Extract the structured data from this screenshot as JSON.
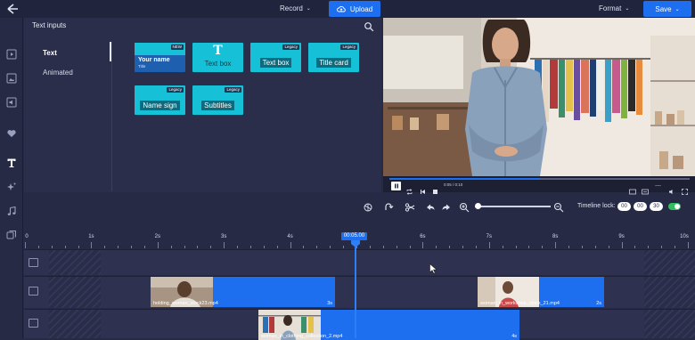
{
  "topbar": {
    "record_label": "Record",
    "upload_label": "Upload",
    "format_label": "Format",
    "save_label": "Save"
  },
  "panel": {
    "title": "Text inputs",
    "categories": [
      "Text",
      "Animated"
    ],
    "active_category": "Text",
    "tiles": [
      {
        "label": "Your name",
        "sublabel": "Title",
        "badge": "NEW"
      },
      {
        "label": "Text box",
        "glyph": "T",
        "badge": ""
      },
      {
        "label": "Text box",
        "badge": "Legacy"
      },
      {
        "label": "Title card",
        "badge": "Legacy"
      },
      {
        "label": "Name sign",
        "badge": "Legacy"
      },
      {
        "label": "Subtitles",
        "badge": "Legacy"
      }
    ]
  },
  "preview": {
    "time_readout": "0:05 / 0:10",
    "progress": 0.5
  },
  "toolbar": {
    "timeline_lock_label": "Timeline lock:",
    "lock_values": [
      "00",
      "00",
      "30"
    ],
    "zoom_level": 0.03
  },
  "timeline": {
    "ticks": [
      "0",
      "1s",
      "2s",
      "3s",
      "4s",
      "5s",
      "6s",
      "7s",
      "8s",
      "9s",
      "10s"
    ],
    "playhead_time": "00:05.00",
    "clips": [
      {
        "name": "holding_woman_stock23.mp4",
        "duration": "3s",
        "row": 1
      },
      {
        "name": "woman_in_workshop_stock_21.mp4",
        "duration": "2s",
        "row": 1
      },
      {
        "name": "woman_in_clothing_collection_2.mp4",
        "duration": "4s",
        "row": 2
      }
    ]
  },
  "colors": {
    "accent": "#1e6ff0",
    "tile": "#16c0d6",
    "background": "#262a45"
  }
}
